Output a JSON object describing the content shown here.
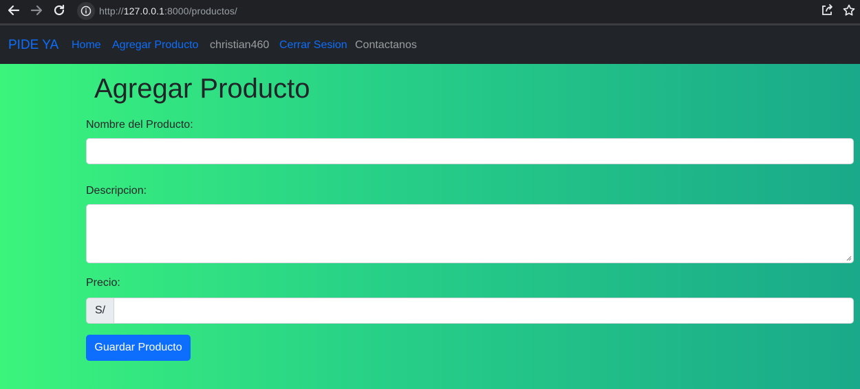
{
  "browser": {
    "url_scheme": "http://",
    "url_host": "127.0.0.1",
    "url_rest": ":8000/productos/",
    "icons": [
      "back-arrow-icon",
      "forward-arrow-icon",
      "reload-icon",
      "info-icon",
      "share-icon",
      "star-icon"
    ]
  },
  "navbar": {
    "brand": "PIDE YA",
    "links": [
      {
        "label": "Home"
      },
      {
        "label": "Agregar Producto"
      },
      {
        "label": "christian460"
      },
      {
        "label": "Cerrar Sesion"
      },
      {
        "label": "Contactanos"
      }
    ]
  },
  "form": {
    "title": "Agregar Producto",
    "name_label": "Nombre del Producto:",
    "name_value": "",
    "description_label": "Descripcion:",
    "description_value": "",
    "price_label": "Precio:",
    "price_prefix": "S/",
    "price_value": "",
    "submit_label": "Guardar Producto"
  },
  "colors": {
    "navbar_bg": "#212529",
    "link_blue": "#0d6efd",
    "gradient_start": "#3bf47c",
    "gradient_end": "#1aa98a",
    "button_bg": "#0d6efd"
  }
}
